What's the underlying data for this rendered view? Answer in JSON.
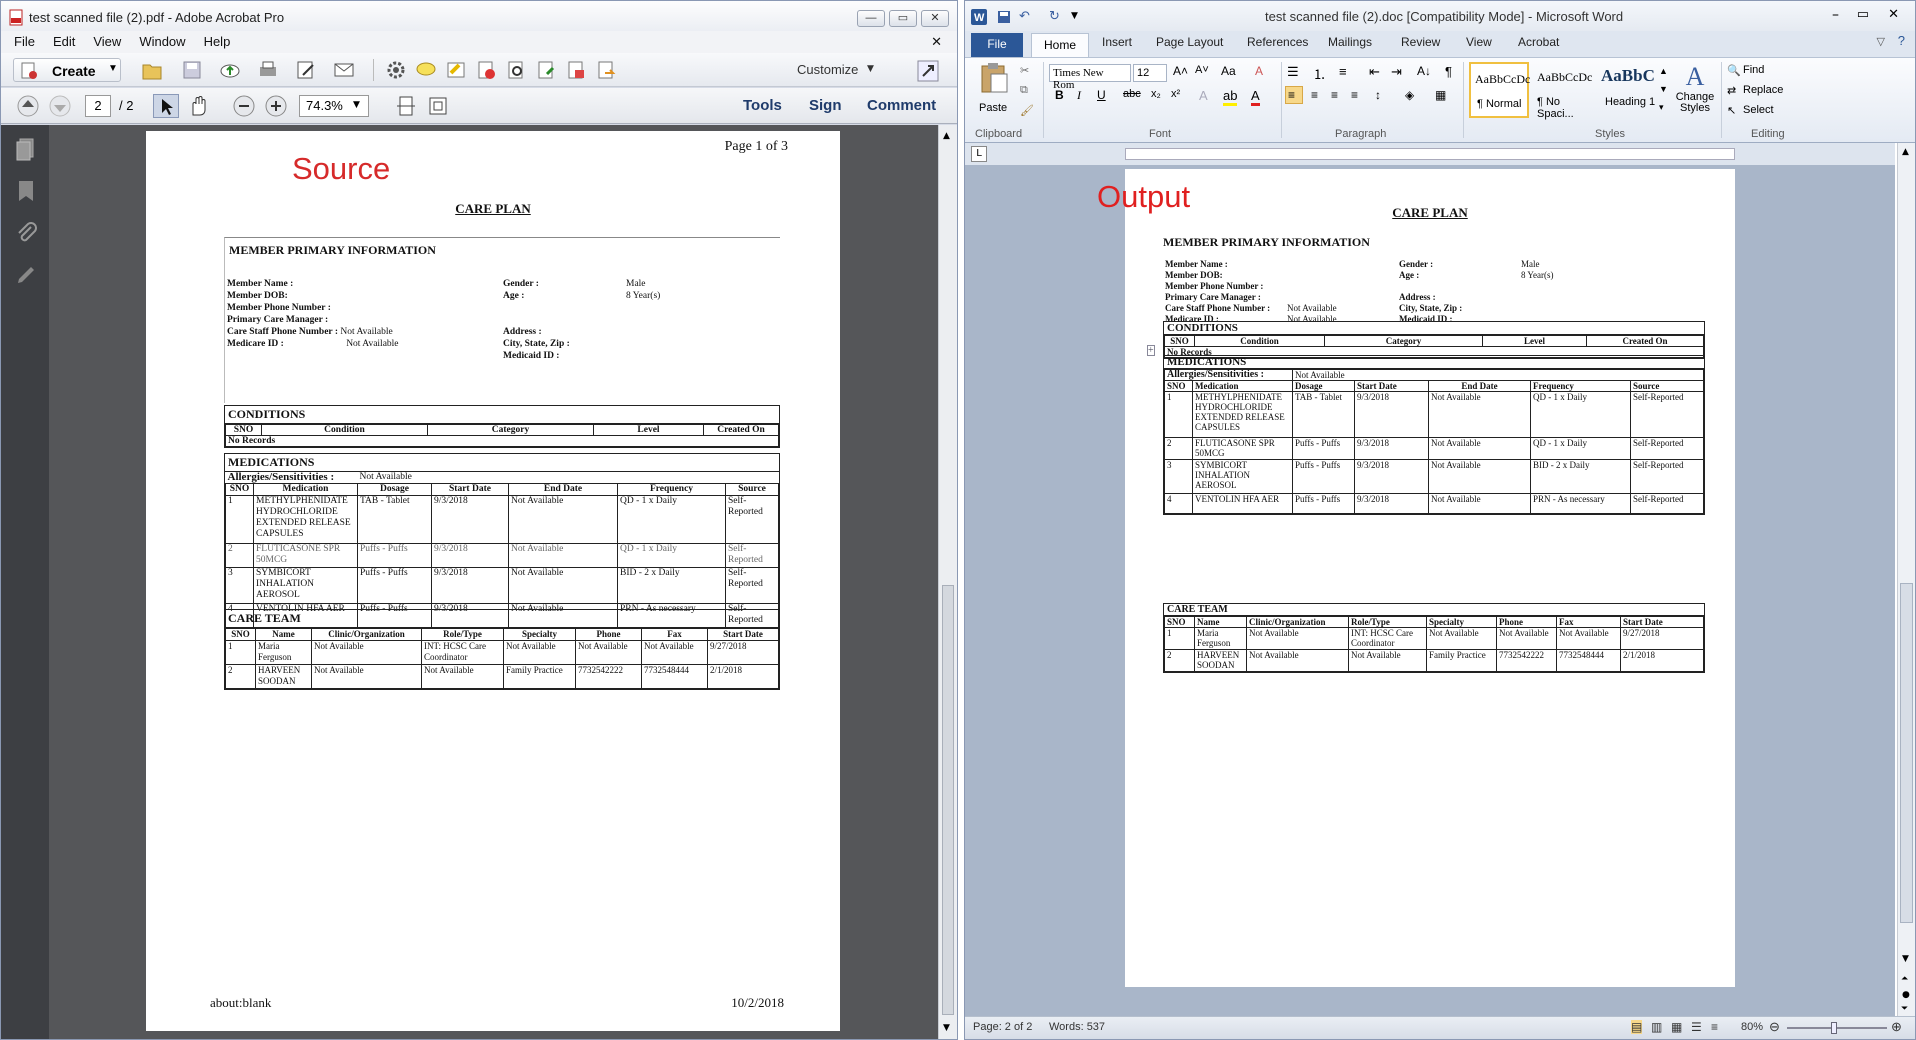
{
  "acrobat": {
    "title": "test scanned file (2).pdf - Adobe Acrobat Pro",
    "menu": [
      "File",
      "Edit",
      "View",
      "Window",
      "Help"
    ],
    "create_label": "Create",
    "customize_label": "Customize",
    "page_current": "2",
    "page_total": "/ 2",
    "zoom": "74.3%",
    "tools_label": "Tools",
    "sign_label": "Sign",
    "comment_label": "Comment",
    "overlay_label": "Source",
    "page": {
      "page_num": "Page 1 of 3",
      "footer_left": "about:blank",
      "footer_right": "10/2/2018"
    }
  },
  "word": {
    "title": "test scanned file (2).doc [Compatibility Mode]  -  Microsoft Word",
    "tabs": [
      "File",
      "Home",
      "Insert",
      "Page Layout",
      "References",
      "Mailings",
      "Review",
      "View",
      "Acrobat"
    ],
    "font_name": "Times New Rom",
    "font_size": "12",
    "paste_label": "Paste",
    "styles": [
      {
        "preview": "AaBbCcDc",
        "name": "¶ Normal"
      },
      {
        "preview": "AaBbCcDc",
        "name": "¶ No Spaci..."
      },
      {
        "preview": "AaBbC",
        "name": "Heading 1"
      }
    ],
    "change_styles_label": "Change Styles",
    "find_label": "Find",
    "replace_label": "Replace",
    "select_label": "Select",
    "groups": [
      "Clipboard",
      "Font",
      "Paragraph",
      "Styles",
      "Editing"
    ],
    "overlay_label": "Output",
    "status_page": "Page: 2 of 2",
    "status_words": "Words: 537",
    "zoom": "80%"
  },
  "doc": {
    "title": "CARE PLAN",
    "member_header": "MEMBER PRIMARY INFORMATION",
    "member_left": [
      {
        "label": "Member Name :",
        "value": ""
      },
      {
        "label": "Member DOB:",
        "value": ""
      },
      {
        "label": "Member Phone Number :",
        "value": ""
      },
      {
        "label": "Primary Care Manager :",
        "value": ""
      },
      {
        "label": "Care Staff Phone Number :",
        "value": "Not Available"
      },
      {
        "label": "Medicare ID :",
        "value": "Not Available"
      }
    ],
    "member_right": [
      {
        "label": "Gender :",
        "value": "Male"
      },
      {
        "label": "Age :",
        "value": "8 Year(s)"
      },
      {
        "label": "",
        "value": ""
      },
      {
        "label": "Address :",
        "value": ""
      },
      {
        "label": "City, State, Zip :",
        "value": ""
      },
      {
        "label": "Medicaid ID :",
        "value": ""
      }
    ],
    "conditions_header": "CONDITIONS",
    "conditions_cols": [
      "SNO",
      "Condition",
      "Category",
      "Level",
      "Created On"
    ],
    "conditions_empty": "No Records",
    "medications_header": "MEDICATIONS",
    "allergies_label": "Allergies/Sensitivities :",
    "allergies_value": "Not Available",
    "med_cols": [
      "SNO",
      "Medication",
      "Dosage",
      "Start Date",
      "End Date",
      "Frequency",
      "Source"
    ],
    "med_rows": [
      [
        "1",
        "METHYLPHENIDATE HYDROCHLORIDE EXTENDED RELEASE CAPSULES",
        "TAB - Tablet",
        "9/3/2018",
        "Not Available",
        "QD - 1 x Daily",
        "Self-Reported"
      ],
      [
        "2",
        "FLUTICASONE SPR 50MCG",
        "Puffs - Puffs",
        "9/3/2018",
        "Not Available",
        "QD - 1 x Daily",
        "Self-Reported"
      ],
      [
        "3",
        "SYMBICORT INHALATION AEROSOL",
        "Puffs - Puffs",
        "9/3/2018",
        "Not Available",
        "BID - 2 x Daily",
        "Self-Reported"
      ],
      [
        "4",
        "VENTOLIN HFA AER",
        "Puffs - Puffs",
        "9/3/2018",
        "Not Available",
        "PRN - As necessary",
        "Self-Reported"
      ]
    ],
    "care_header": "CARE TEAM",
    "care_cols": [
      "SNO",
      "Name",
      "Clinic/Organization",
      "Role/Type",
      "Specialty",
      "Phone",
      "Fax",
      "Start Date"
    ],
    "care_rows": [
      [
        "1",
        "Maria Ferguson",
        "Not Available",
        "INT: HCSC Care Coordinator",
        "Not Available",
        "Not Available",
        "Not Available",
        "9/27/2018"
      ],
      [
        "2",
        "HARVEEN SOODAN",
        "Not Available",
        "Not Available",
        "Family Practice",
        "7732542222",
        "7732548444",
        "2/1/2018"
      ]
    ]
  }
}
